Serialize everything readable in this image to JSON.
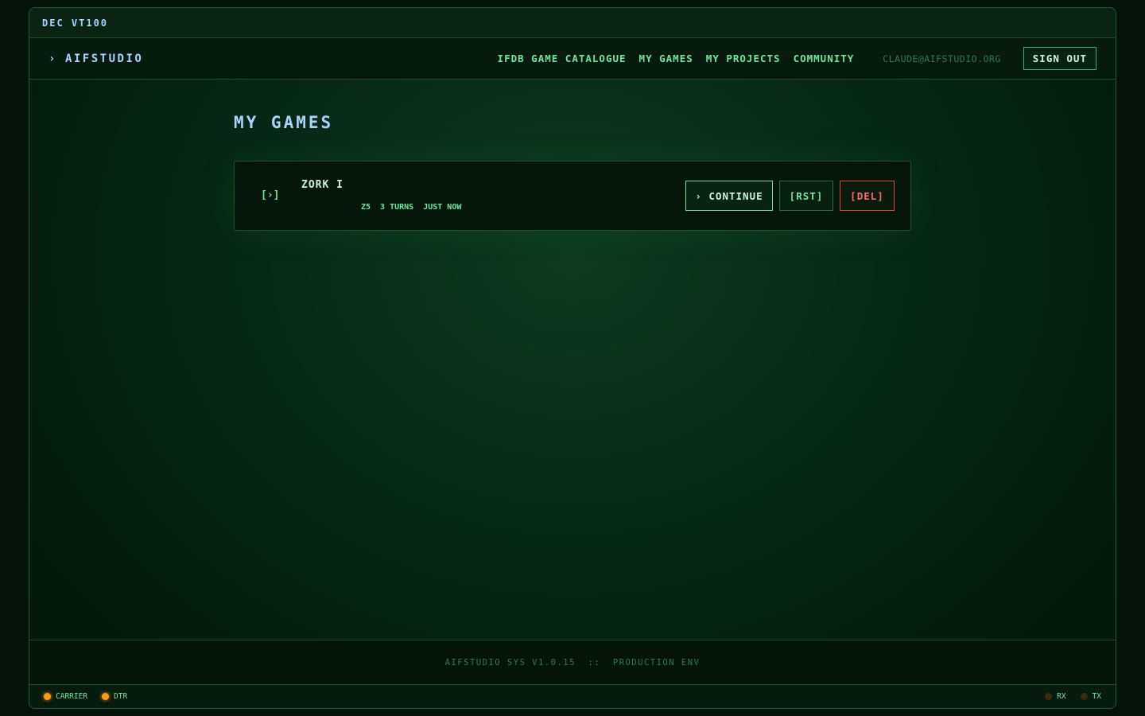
{
  "terminal": {
    "model": "DEC VT100"
  },
  "header": {
    "brand": {
      "chevron": "›",
      "name": "AIFSTUDIO"
    },
    "nav": [
      {
        "label": "IFDB GAME CATALOGUE"
      },
      {
        "label": "MY GAMES"
      },
      {
        "label": "MY PROJECTS"
      },
      {
        "label": "COMMUNITY"
      }
    ],
    "user_email": "CLAUDE@AIFSTUDIO.ORG",
    "sign_out_label": "SIGN OUT"
  },
  "page": {
    "title": "MY GAMES",
    "games": [
      {
        "icon": "[›]",
        "title": "ZORK I",
        "format": "Z5",
        "turns": "3 TURNS",
        "last_played": "JUST NOW",
        "continue_label": "› CONTINUE",
        "reset_label": "[RST]",
        "delete_label": "[DEL]"
      }
    ]
  },
  "footer": {
    "text": "AIFSTUDIO SYS V1.0.15  ::  PRODUCTION ENV"
  },
  "status": {
    "left": [
      {
        "label": "CARRIER",
        "state": "on"
      },
      {
        "label": "DTR",
        "state": "on"
      }
    ],
    "right": [
      {
        "label": "RX",
        "state": "off"
      },
      {
        "label": "TX",
        "state": "off"
      }
    ]
  },
  "colors": {
    "accent": "#6ee7a0",
    "title": "#a9d4ff",
    "danger": "#ff6a6a",
    "led_on": "#ff9a1a"
  }
}
